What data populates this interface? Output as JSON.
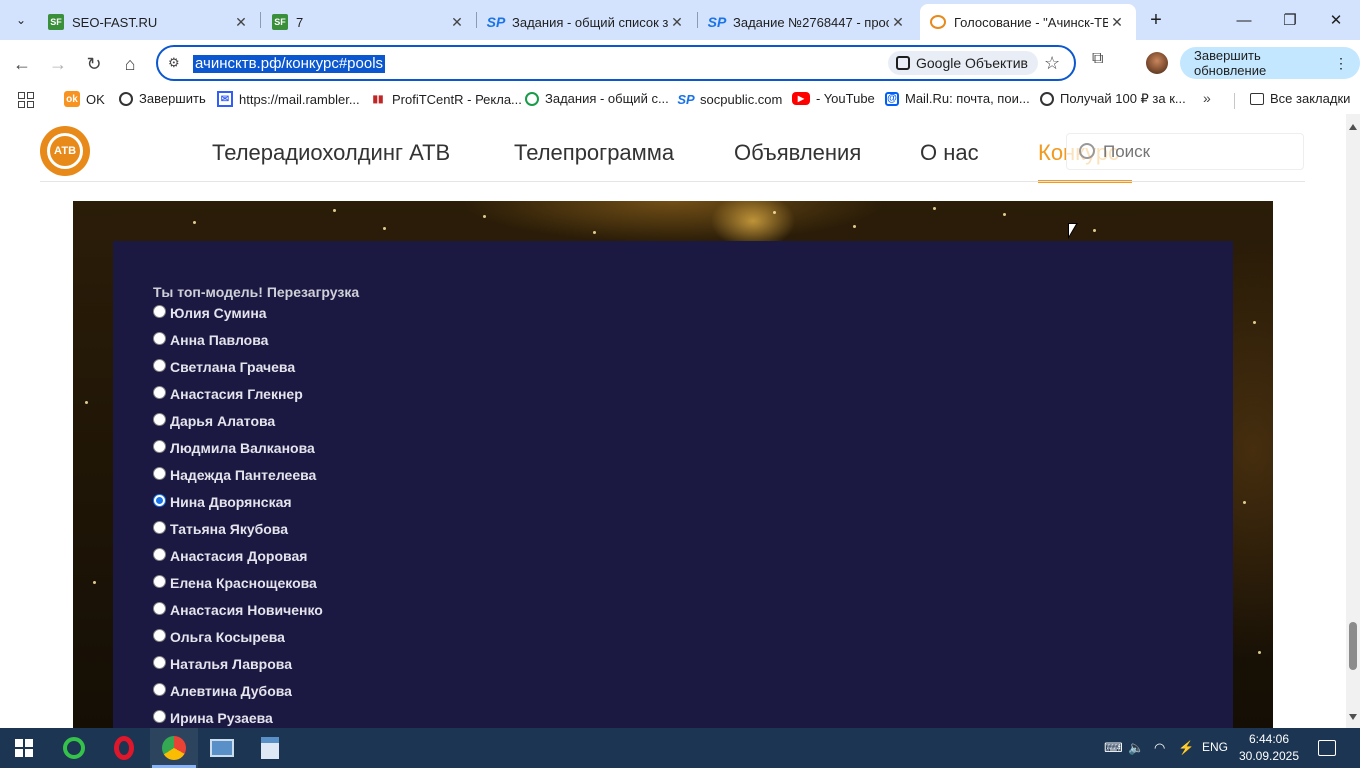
{
  "browser": {
    "tabs": [
      {
        "title": "SEO-FAST.RU",
        "favicon": "SF",
        "active": false
      },
      {
        "title": "7",
        "favicon": "SF",
        "active": false
      },
      {
        "title": "Задания - общий список за",
        "favicon": "SP",
        "active": false
      },
      {
        "title": "Задание №2768447 - прос",
        "favicon": "SP",
        "active": false
      },
      {
        "title": "Голосование - \"Ачинск-ТВ\"",
        "favicon": "atv",
        "active": true
      }
    ],
    "url": "ачинсктв.рф/конкурс#pools",
    "lens_label": "Google Объектив",
    "update_label": "Завершить обновление",
    "bookmarks": [
      {
        "label": "OK",
        "icon": "ok-icon"
      },
      {
        "label": "Завершить",
        "icon": "globe-icon"
      },
      {
        "label": "https://mail.rambler...",
        "icon": "mail-icon"
      },
      {
        "label": "ProfiTCentR - Рекла...",
        "icon": "chart-icon"
      },
      {
        "label": "Задания - общий с...",
        "icon": "target-icon"
      },
      {
        "label": "socpublic.com",
        "icon": "sp-icon"
      },
      {
        "label": "- YouTube",
        "icon": "youtube-icon"
      },
      {
        "label": "Mail.Ru: почта, пои...",
        "icon": "mailru-icon"
      },
      {
        "label": "Получай 100 ₽ за к...",
        "icon": "globe-icon"
      }
    ],
    "all_bookmarks_label": "Все закладки"
  },
  "site": {
    "logo_text": "АТВ",
    "nav": [
      "Телерадиохолдинг АТВ",
      "Телепрограмма",
      "Объявления",
      "О нас",
      "Конкурс"
    ],
    "active_nav": "Конкурс",
    "search_placeholder": "Поиск"
  },
  "poll": {
    "title": "Ты топ-модель! Перезагрузка",
    "options": [
      "Юлия Сумина",
      "Анна Павлова",
      "Светлана Грачева",
      "Анастасия Глекнер",
      "Дарья Алатова",
      "Людмила Валканова",
      "Надежда Пантелеева",
      "Нина Дворянская",
      "Татьяна Якубова",
      "Анастасия Доровая",
      "Елена Краснощекова",
      "Анастасия Новиченко",
      "Ольга Косырева",
      "Наталья Лаврова",
      "Алевтина Дубова",
      "Ирина Рузаева"
    ],
    "selected": "Нина Дворянская"
  },
  "taskbar": {
    "language": "ENG",
    "time": "6:44:06",
    "date": "30.09.2025"
  },
  "colors": {
    "accent": "#f29a1f",
    "panel": "#1b1842",
    "omnibox_focus": "#0b57d0",
    "taskbar": "#1c3552"
  }
}
